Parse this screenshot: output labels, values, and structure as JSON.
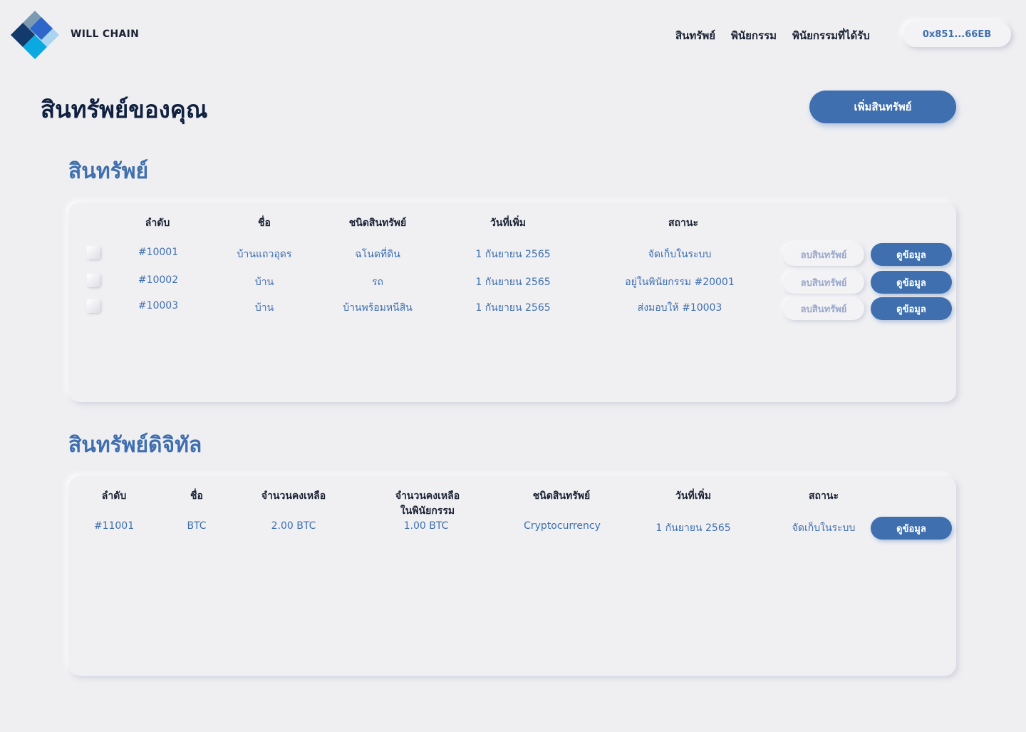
{
  "header": {
    "brand": "WILL CHAIN",
    "nav": [
      "สินทรัพย์",
      "พินัยกรรม",
      "พินัยกรรมที่ได้รับ"
    ],
    "wallet": "0x851...66EB"
  },
  "page": {
    "title": "สินทรัพย์ของคุณ",
    "add_button": "เพิ่มสินทรัพย์"
  },
  "assets": {
    "title": "สินทรัพย์",
    "columns": [
      "ลำดับ",
      "ชื่อ",
      "ชนิดสินทรัพย์",
      "วันที่เพิ่ม",
      "สถานะ"
    ],
    "delete_label": "ลบสินทรัพย์",
    "view_label": "ดูข้อมูล",
    "rows": [
      [
        "#10001",
        "บ้านแถวอุดร",
        "ฉโนดที่ดิน",
        "1 กันยายน 2565",
        "จัดเก็บในระบบ"
      ],
      [
        "#10002",
        "บ้าน",
        "รถ",
        "1 กันยายน 2565",
        "อยู่ในพินัยกรรม #20001"
      ],
      [
        "#10003",
        "บ้าน",
        "บ้านพร้อมหนีสิน",
        "1 กันยายน 2565",
        "ส่งมอบให้ #10003"
      ]
    ]
  },
  "digital": {
    "title": "สินทรัพย์ดิจิทัล",
    "columns": [
      "ลำดับ",
      "ชื่อ",
      "จำนวนคงเหลือ",
      "จำนวนคงเหลือ\nในพินัยกรรม",
      "ชนิดสินทรัพย์",
      "วันที่เพิ่ม",
      "สถานะ"
    ],
    "view_label": "ดูข้อมูล",
    "rows": [
      [
        "#11001",
        "BTC",
        "2.00 BTC",
        "1.00 BTC",
        "Cryptocurrency",
        "1 กันยายน 2565",
        "จัดเก็บในระบบ"
      ]
    ]
  },
  "colors": {
    "accent": "#3f6fae",
    "background": "#efeff2",
    "heading": "#10203f"
  }
}
